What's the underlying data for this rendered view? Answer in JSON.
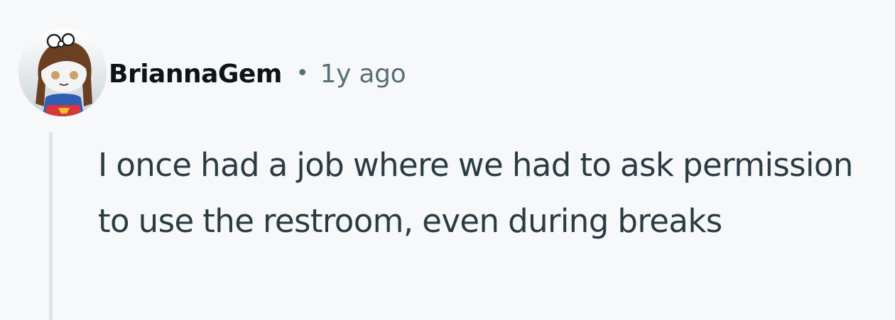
{
  "comment": {
    "author": "BriannaGem",
    "separator": "•",
    "timestamp": "1y ago",
    "body": "I once had a job where we had to ask permission to use the restroom, even during breaks",
    "avatar_icon": "snoo-avatar-icon"
  },
  "colors": {
    "background": "#f7f8fa",
    "author_text": "#0b1416",
    "meta_text": "#576f76",
    "body_text": "#2a3c42",
    "thread_line": "#dfe3e6"
  }
}
